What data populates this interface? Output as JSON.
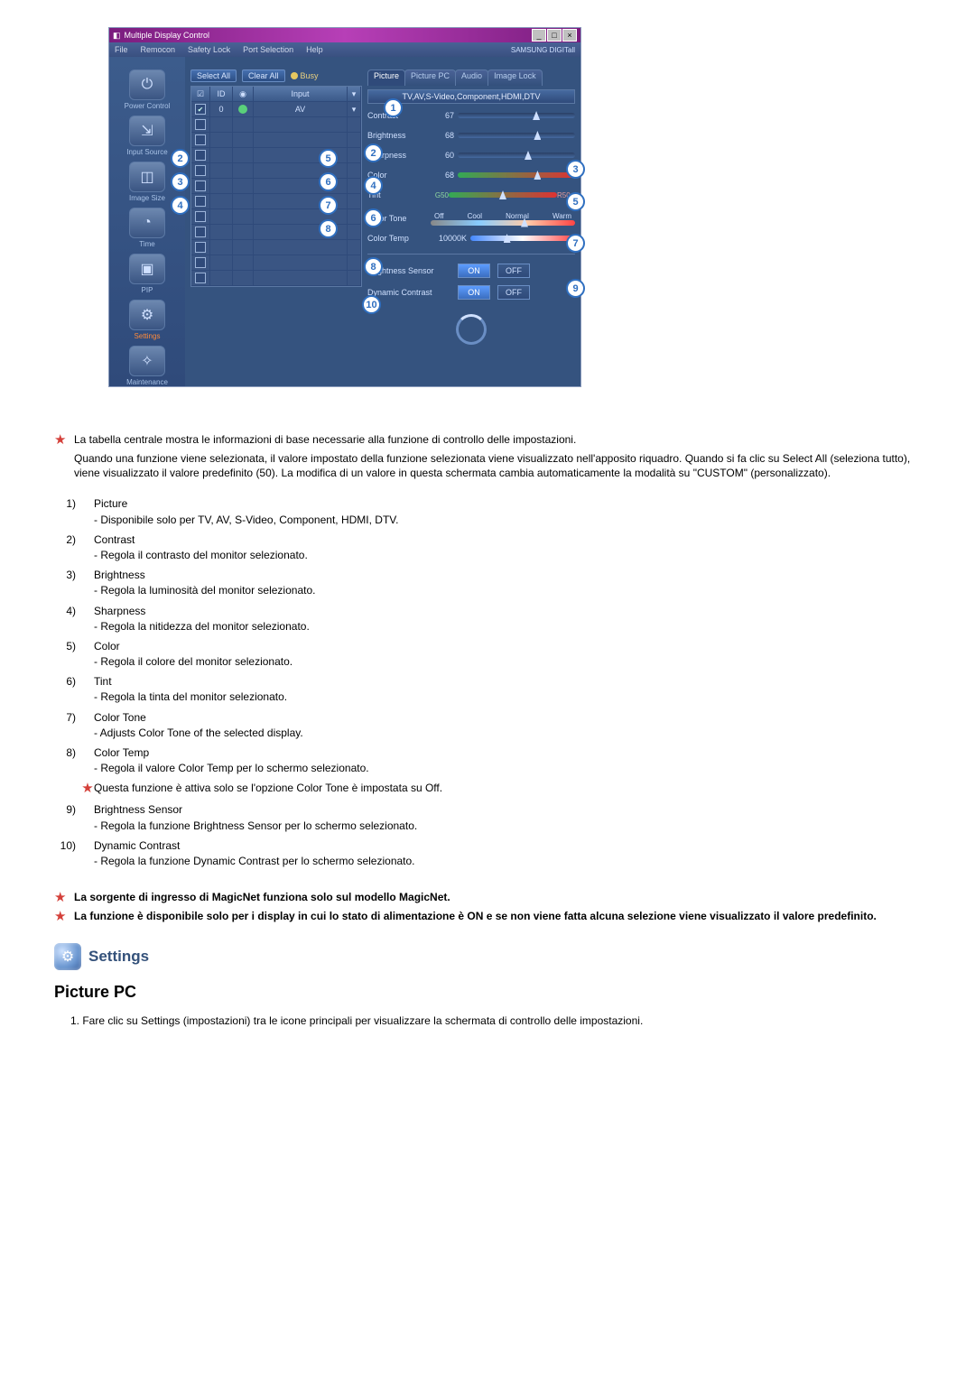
{
  "app": {
    "title": "Multiple Display Control",
    "menu": [
      "File",
      "Remocon",
      "Safety Lock",
      "Port Selection",
      "Help"
    ],
    "brand": "SAMSUNG DIGITall",
    "buttons": {
      "select_all": "Select All",
      "clear_all": "Clear All",
      "busy": "Busy"
    },
    "sidebar": [
      {
        "label": "Power Control",
        "glyph": "⏻"
      },
      {
        "label": "Input Source",
        "glyph": "⇲"
      },
      {
        "label": "Image Size",
        "glyph": "◫"
      },
      {
        "label": "Time",
        "glyph": "◔"
      },
      {
        "label": "PIP",
        "glyph": "▣"
      },
      {
        "label": "Settings",
        "glyph": "⚙"
      },
      {
        "label": "Maintenance",
        "glyph": "✧"
      }
    ],
    "grid": {
      "headers": {
        "chk": "✔",
        "id": "ID",
        "status": "●",
        "input": "Input"
      },
      "rows": [
        {
          "chk": true,
          "id": "0",
          "status": "#5ad07a",
          "input": "AV"
        },
        {
          "chk": false,
          "id": "",
          "status": "",
          "input": ""
        },
        {
          "chk": false,
          "id": "",
          "status": "",
          "input": ""
        },
        {
          "chk": false,
          "id": "",
          "status": "",
          "input": ""
        },
        {
          "chk": false,
          "id": "",
          "status": "",
          "input": ""
        },
        {
          "chk": false,
          "id": "",
          "status": "",
          "input": ""
        },
        {
          "chk": false,
          "id": "",
          "status": "",
          "input": ""
        },
        {
          "chk": false,
          "id": "",
          "status": "",
          "input": ""
        },
        {
          "chk": false,
          "id": "",
          "status": "",
          "input": ""
        },
        {
          "chk": false,
          "id": "",
          "status": "",
          "input": ""
        },
        {
          "chk": false,
          "id": "",
          "status": "",
          "input": ""
        },
        {
          "chk": false,
          "id": "",
          "status": "",
          "input": ""
        }
      ]
    },
    "panel": {
      "tabs": [
        "Picture",
        "Picture PC",
        "Audio",
        "Image Lock"
      ],
      "active_tab": 0,
      "mode_note": "TV,AV,S-Video,Component,HDMI,DTV",
      "sliders": {
        "contrast": {
          "label": "Contrast",
          "value": 67
        },
        "brightness": {
          "label": "Brightness",
          "value": 68
        },
        "sharpness": {
          "label": "Sharpness",
          "value": 60
        },
        "color": {
          "label": "Color",
          "value": 68
        },
        "tint": {
          "label": "Tint",
          "left": "G50",
          "right": "R50",
          "value": 50
        }
      },
      "color_tone": {
        "label": "Color Tone",
        "options": [
          "Off",
          "Cool",
          "Normal",
          "Warm"
        ]
      },
      "color_temp": {
        "label": "Color Temp",
        "value_text": "10000K"
      },
      "brightness_sensor": {
        "label": "Brightness Sensor",
        "on": "ON",
        "off": "OFF",
        "state": "ON"
      },
      "dynamic_contrast": {
        "label": "Dynamic Contrast",
        "on": "ON",
        "off": "OFF",
        "state": "ON"
      }
    }
  },
  "badges": {
    "b1": "1",
    "b2_left": "2",
    "b2_right": "2",
    "b3_left": "3",
    "b3_right": "3",
    "b4_left": "4",
    "b4_right": "4",
    "b5_left": "5",
    "b5_right": "5",
    "b6_left": "6",
    "b6_right": "6",
    "b7_left": "7",
    "b7_right": "7",
    "b8_left": "8",
    "b8_right": "8",
    "b9": "9",
    "b10": "10"
  },
  "notes": {
    "intro": [
      "La tabella centrale mostra le informazioni di base necessarie alla funzione di controllo delle impostazioni.",
      "Quando una funzione viene selezionata, il valore impostato della funzione selezionata viene visualizzato nell'apposito riquadro. Quando si fa clic su Select All (seleziona tutto), viene visualizzato il valore predefinito (50). La modifica di un valore in questa schermata cambia automaticamente la modalità su \"CUSTOM\" (personalizzato)."
    ],
    "defs": [
      {
        "n": "1",
        "title": "Picture",
        "desc": "- Disponibile solo per TV, AV, S-Video, Component, HDMI, DTV."
      },
      {
        "n": "2",
        "title": "Contrast",
        "desc": "- Regola il contrasto del monitor selezionato."
      },
      {
        "n": "3",
        "title": "Brightness",
        "desc": "- Regola la luminosità del monitor selezionato."
      },
      {
        "n": "4",
        "title": "Sharpness",
        "desc": "- Regola la nitidezza del monitor selezionato."
      },
      {
        "n": "5",
        "title": "Color",
        "desc": "- Regola il colore del monitor selezionato."
      },
      {
        "n": "6",
        "title": "Tint",
        "desc": "- Regola la tinta del monitor selezionato."
      },
      {
        "n": "7",
        "title": "Color Tone",
        "desc": "- Adjusts Color Tone of the selected display."
      },
      {
        "n": "8",
        "title": "Color Temp",
        "desc": "- Regola il valore Color Temp per lo schermo selezionato."
      },
      {
        "n": "*",
        "star": true,
        "title": "",
        "desc": "Questa funzione è attiva solo se l'opzione Color Tone è impostata su Off."
      },
      {
        "n": "9",
        "title": "Brightness Sensor",
        "desc": "- Regola la funzione Brightness Sensor per lo schermo selezionato."
      },
      {
        "n": "10",
        "title": "Dynamic Contrast",
        "desc": "- Regola la funzione Dynamic Contrast per lo schermo selezionato."
      }
    ],
    "footer": [
      "La sorgente di ingresso di MagicNet funziona solo sul modello MagicNet.",
      "La funzione è disponibile solo per i display in cui lo stato di alimentazione è ON e se non viene fatta alcuna selezione viene visualizzato il valore predefinito."
    ]
  },
  "section": {
    "settings_title": "Settings",
    "picture_pc_title": "Picture PC",
    "picture_pc_step": "1. Fare clic su Settings (impostazioni) tra le icone principali per visualizzare la schermata di controllo delle impostazioni."
  }
}
